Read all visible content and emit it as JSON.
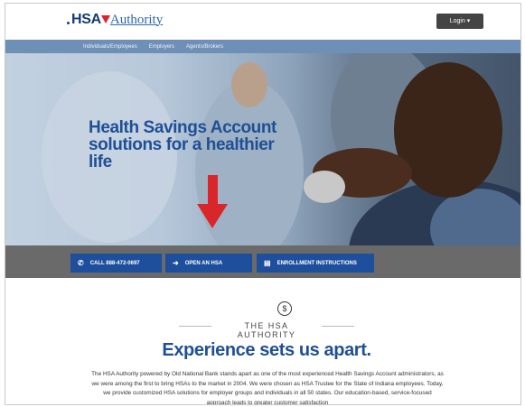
{
  "header": {
    "logo_hsa": "HSA",
    "logo_authority": "Authority",
    "login_label": "Login ▾"
  },
  "nav": {
    "items": [
      "Individuals/Employees",
      "Employers",
      "Agents/Brokers"
    ]
  },
  "hero": {
    "title": "Health Savings Account solutions for a healthier life"
  },
  "actions": {
    "call_label": "CALL 888-472-0697",
    "open_label": "OPEN AN HSA",
    "enroll_label": "ENROLLMENT INSTRUCTIONS"
  },
  "about": {
    "dollar_symbol": "$",
    "brand_label": "THE HSA AUTHORITY",
    "headline": "Experience sets us apart.",
    "paragraph": "The HSA Authority powered by Old National Bank stands apart as one of the most experienced Health Savings Account administrators, as we were among the first to bring HSAs to the market in 2004. We were chosen as HSA Trustee for the State of Indiana employees. Today, we provide customized HSA solutions for employer groups and individuals in all 50 states. Our education-based, service-focused approach leads to greater customer satisfaction"
  },
  "colors": {
    "brand_blue": "#1f4f96",
    "button_blue": "#1d4f9c",
    "accent_red": "#d8262a",
    "nav_blue": "#6e8fb6"
  },
  "icons": {
    "call": "phone-icon",
    "open": "enter-arrow-icon",
    "enroll": "document-icon"
  }
}
